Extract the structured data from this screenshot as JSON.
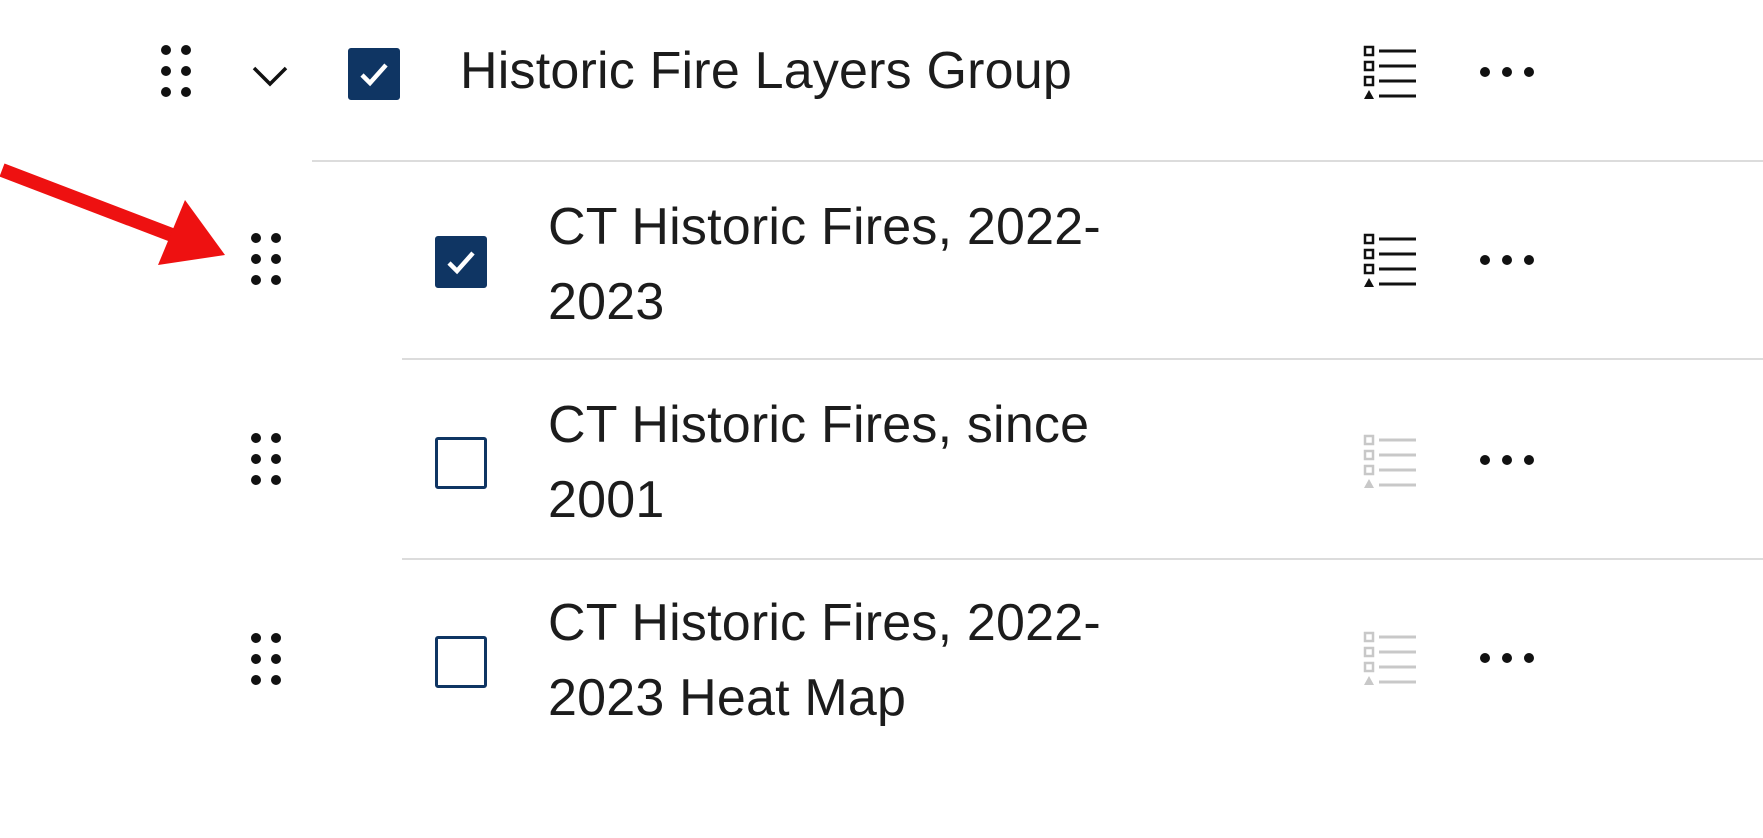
{
  "layer_list": {
    "group": {
      "title": "Historic Fire Layers Group",
      "expanded": true,
      "checked": true,
      "legend_enabled": true
    },
    "layers": [
      {
        "title": "CT Historic Fires, 2022-2023",
        "checked": true,
        "legend_enabled": true
      },
      {
        "title": "CT Historic Fires, since 2001",
        "checked": false,
        "legend_enabled": false
      },
      {
        "title": "CT Historic Fires, 2022-2023 Heat Map",
        "checked": false,
        "legend_enabled": false
      }
    ]
  },
  "annotation": {
    "arrow_color": "#ee1111",
    "points_to": "drag-handle"
  },
  "colors": {
    "checkbox": "#0f3563",
    "icon_enabled": "#111111",
    "icon_disabled": "#c8c8c8",
    "divider": "#dcdcdc"
  },
  "icons": {
    "drag": "drag-handle-icon",
    "expand": "chevron-down-icon",
    "legend": "legend-icon",
    "options": "more-options-icon",
    "check": "check-icon"
  }
}
